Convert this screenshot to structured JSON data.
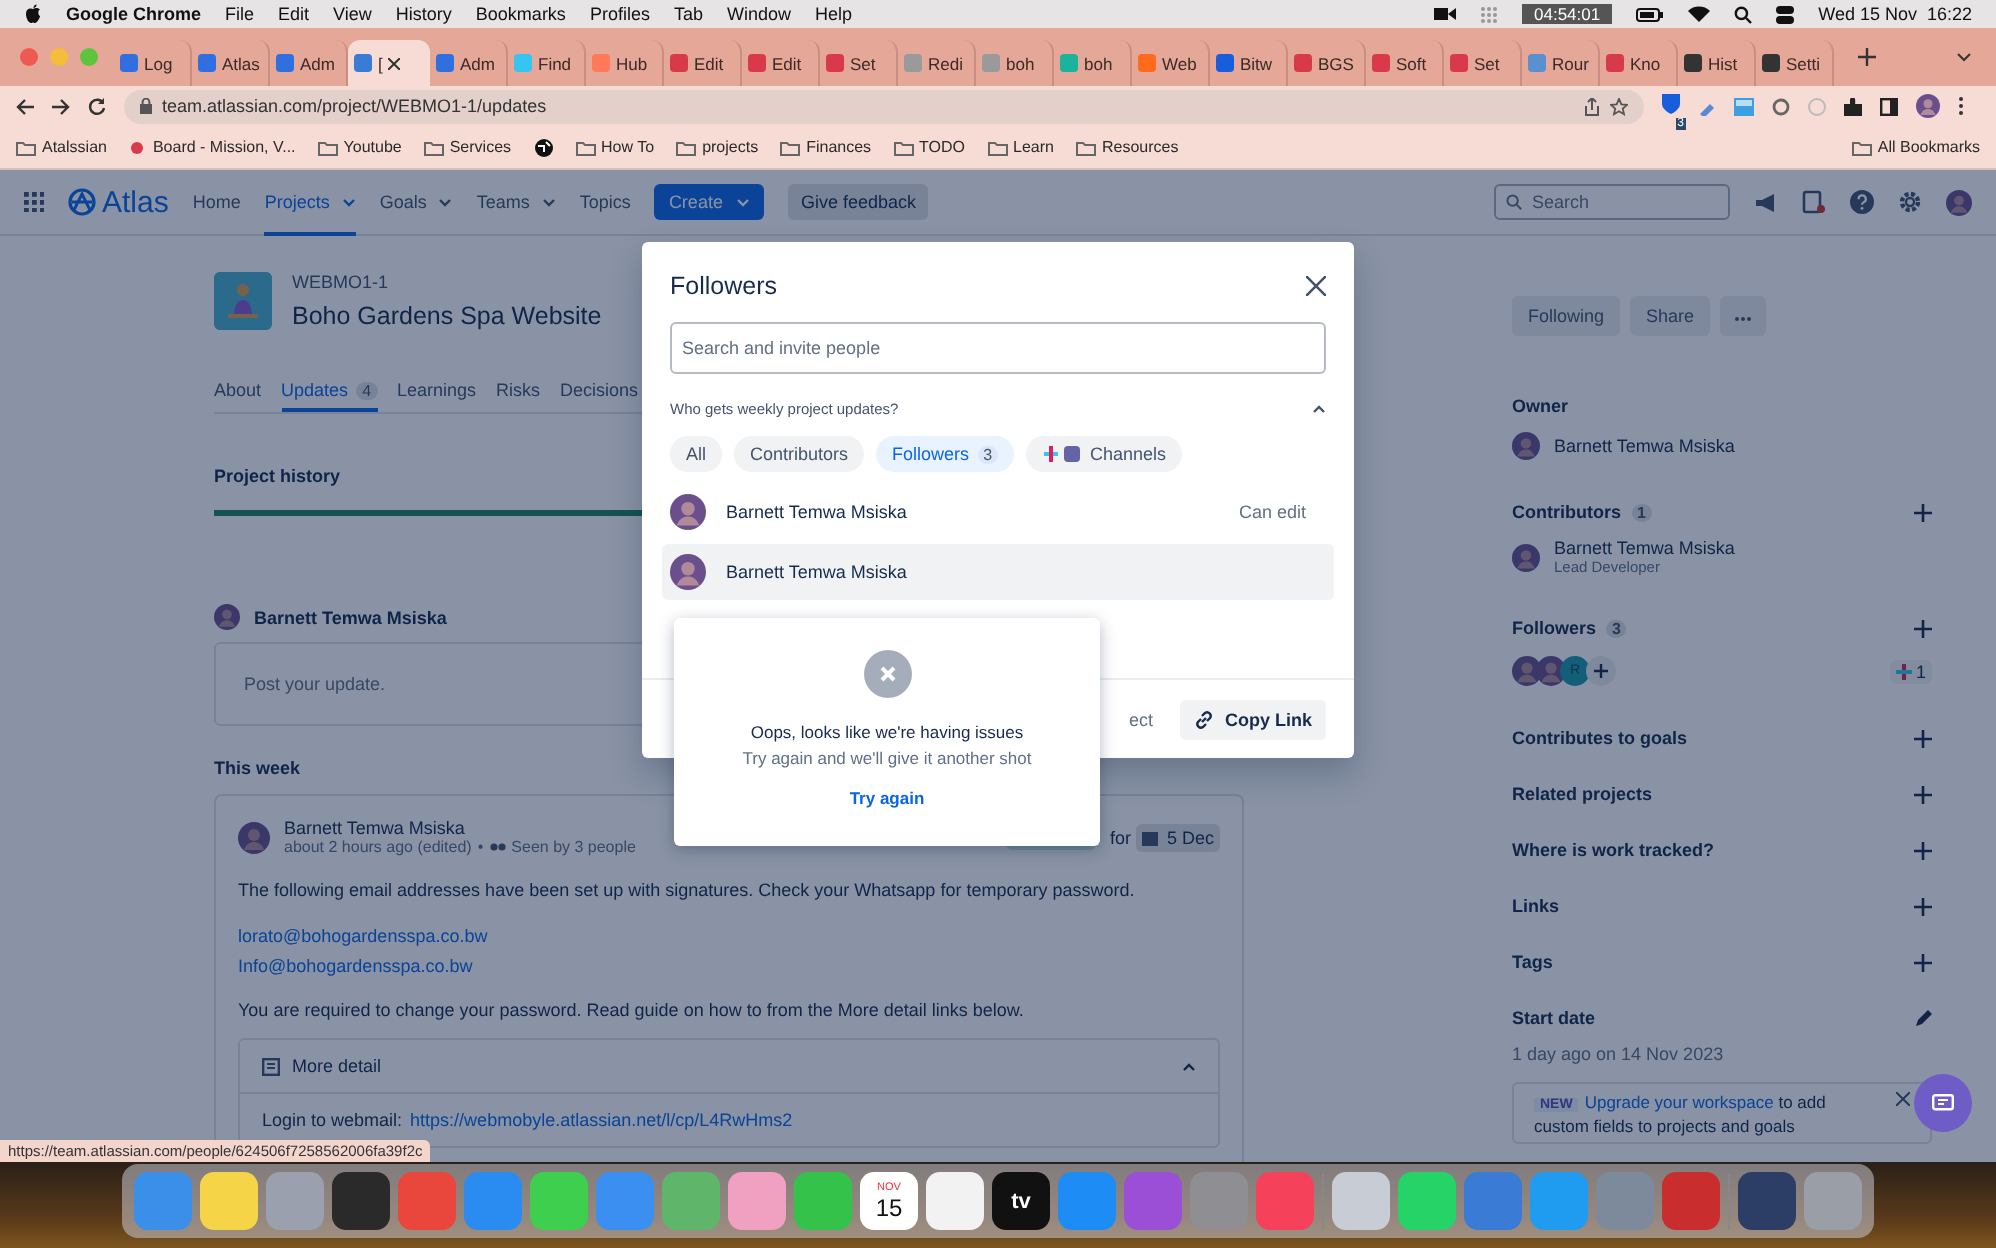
{
  "menu_bar": {
    "app": "Google Chrome",
    "items": [
      "File",
      "Edit",
      "View",
      "History",
      "Bookmarks",
      "Profiles",
      "Tab",
      "Window",
      "Help"
    ],
    "timer": "04:54:01",
    "clock": "Wed 15 Nov  16:22"
  },
  "browser": {
    "tabs": [
      {
        "label": "Log",
        "color": "#2f6fe0",
        "selected": false
      },
      {
        "label": "Atlas",
        "color": "#2f6fe0",
        "selected": false
      },
      {
        "label": "Adm",
        "color": "#2f6fe0",
        "selected": false
      },
      {
        "label": "[",
        "color": "#3a7bd5",
        "selected": true
      },
      {
        "label": "Adm",
        "color": "#2f6fe0",
        "selected": false
      },
      {
        "label": "Find",
        "color": "#36c5f0",
        "selected": false
      },
      {
        "label": "Hub",
        "color": "#ff7a59",
        "selected": false
      },
      {
        "label": "Edit",
        "color": "#d93a4a",
        "selected": false
      },
      {
        "label": "Edit",
        "color": "#d93a4a",
        "selected": false
      },
      {
        "label": "Set",
        "color": "#d93a4a",
        "selected": false
      },
      {
        "label": "Redi",
        "color": "#9a9a9a",
        "selected": false
      },
      {
        "label": "boh",
        "color": "#9a9a9a",
        "selected": false
      },
      {
        "label": "boh",
        "color": "#1bb39b",
        "selected": false
      },
      {
        "label": "Web",
        "color": "#ff6a1f",
        "selected": false
      },
      {
        "label": "Bitw",
        "color": "#175ddc",
        "selected": false
      },
      {
        "label": "BGS",
        "color": "#d93a4a",
        "selected": false
      },
      {
        "label": "Soft",
        "color": "#d93a4a",
        "selected": false
      },
      {
        "label": "Set",
        "color": "#d93a4a",
        "selected": false
      },
      {
        "label": "Rour",
        "color": "#5a8fd0",
        "selected": false
      },
      {
        "label": "Kno",
        "color": "#d93a4a",
        "selected": false
      },
      {
        "label": "Hist",
        "color": "#333333",
        "selected": false
      },
      {
        "label": "Setti",
        "color": "#333333",
        "selected": false
      }
    ],
    "url": "team.atlassian.com/project/WEBMO1-1/updates",
    "extension_badge": "3",
    "bookmarks": [
      {
        "kind": "folder",
        "label": "Atalssian"
      },
      {
        "kind": "page",
        "label": "Board - Mission, V..."
      },
      {
        "kind": "folder",
        "label": "Youtube"
      },
      {
        "kind": "folder",
        "label": "Services"
      },
      {
        "kind": "globe"
      },
      {
        "kind": "folder",
        "label": "How To"
      },
      {
        "kind": "folder",
        "label": "projects"
      },
      {
        "kind": "folder",
        "label": "Finances"
      },
      {
        "kind": "folder",
        "label": "TODO"
      },
      {
        "kind": "folder",
        "label": "Learn"
      },
      {
        "kind": "folder",
        "label": "Resources"
      }
    ],
    "all_bookmarks": "All Bookmarks",
    "status_url": "https://team.atlassian.com/people/624506f7258562006fa39f2c"
  },
  "nav": {
    "logo": "Atlas",
    "items": [
      {
        "label": "Home",
        "selected": false,
        "dropdown": false
      },
      {
        "label": "Projects",
        "selected": true,
        "dropdown": true
      },
      {
        "label": "Goals",
        "selected": false,
        "dropdown": true
      },
      {
        "label": "Teams",
        "selected": false,
        "dropdown": true
      },
      {
        "label": "Topics",
        "selected": false,
        "dropdown": false
      }
    ],
    "create": "Create",
    "feedback": "Give feedback",
    "search_placeholder": "Search"
  },
  "project": {
    "key": "WEBMO1-1",
    "name": "Boho Gardens Spa Website",
    "tabs": [
      {
        "label": "About",
        "selected": false
      },
      {
        "label": "Updates",
        "count": "4",
        "selected": true
      },
      {
        "label": "Learnings",
        "selected": false
      },
      {
        "label": "Risks",
        "selected": false
      },
      {
        "label": "Decisions",
        "selected": false
      }
    ],
    "history_title": "Project history",
    "composer": {
      "author": "Barnett Temwa Msiska",
      "placeholder": "Post your update."
    },
    "section": "This week",
    "update": {
      "author": "Barnett Temwa Msiska",
      "time": "about 2 hours ago (edited)",
      "separator": "•",
      "seen": "Seen by 3 people",
      "due_prefix": "for",
      "due": "5 Dec",
      "paragraphs": [
        {
          "kind": "text",
          "text": "The following email addresses have been set up with signatures. Check your Whatsapp for temporary password."
        },
        {
          "kind": "link",
          "text": "lorato@bohogardensspa.co.bw"
        },
        {
          "kind": "link",
          "text": "Info@bohogardensspa.co.bw"
        },
        {
          "kind": "text",
          "text": "You are required to change your password. Read guide on how to from the More detail links below."
        }
      ],
      "detail": {
        "title": "More detail",
        "expanded": true,
        "line_label": "Login to webmail:",
        "line_link": "https://webmobyle.atlassian.net/l/cp/L4RwHms2"
      }
    }
  },
  "sidebar": {
    "buttons": [
      "Following",
      "Share"
    ],
    "sections": [
      {
        "kind": "person",
        "title": "Owner",
        "add": false,
        "name": "Barnett Temwa Msiska"
      },
      {
        "kind": "person",
        "title": "Contributors",
        "count": "1",
        "add": true,
        "name": "Barnett Temwa Msiska",
        "role": "Lead Developer"
      },
      {
        "kind": "followers",
        "title": "Followers",
        "count": "3",
        "add": true,
        "initial": "R",
        "channel_count": "1"
      },
      {
        "kind": "plain",
        "title": "Contributes to goals",
        "add": true
      },
      {
        "kind": "plain",
        "title": "Related projects",
        "add": true
      },
      {
        "kind": "plain",
        "title": "Where is work tracked?",
        "add": true
      },
      {
        "kind": "plain",
        "title": "Links",
        "add": true
      },
      {
        "kind": "plain",
        "title": "Tags",
        "add": true
      },
      {
        "kind": "date",
        "title": "Start date",
        "add": false,
        "value": "1 day ago on 14 Nov 2023"
      }
    ],
    "banner": {
      "badge": "NEW",
      "link": "Upgrade your workspace",
      "text": "to add custom fields to projects and goals"
    }
  },
  "modal": {
    "title": "Followers",
    "search_placeholder": "Search and invite people",
    "question": "Who gets weekly project updates?",
    "expanded": true,
    "filters": [
      {
        "label": "All",
        "kind": "plain",
        "selected": false
      },
      {
        "label": "Contributors",
        "kind": "plain",
        "selected": false
      },
      {
        "label": "Followers",
        "kind": "plain",
        "count": "3",
        "selected": true
      },
      {
        "label": "Channels",
        "kind": "channels",
        "selected": false
      }
    ],
    "people": [
      {
        "name": "Barnett Temwa Msiska",
        "permission": "Can edit",
        "highlighted": false
      },
      {
        "name": "Barnett Temwa Msiska",
        "highlighted": true
      }
    ],
    "footer_partial": "ect",
    "copy_link": "Copy Link"
  },
  "error": {
    "title": "Oops, looks like we're having issues",
    "message": "Try again and we'll give it another shot",
    "action": "Try again"
  },
  "dock": [
    {
      "kind": "app",
      "color": "#3b8fe8"
    },
    {
      "kind": "app",
      "color": "#f5d547"
    },
    {
      "kind": "app",
      "color": "#9aa0ad"
    },
    {
      "kind": "app",
      "color": "#2a2a2a"
    },
    {
      "kind": "app",
      "color": "#e9473b"
    },
    {
      "kind": "app",
      "color": "#2a8cf0"
    },
    {
      "kind": "app",
      "color": "#3ecf4f"
    },
    {
      "kind": "app",
      "color": "#3a8ff0"
    },
    {
      "kind": "app",
      "color": "#5fb56a"
    },
    {
      "kind": "app",
      "color": "#f0a0c0"
    },
    {
      "kind": "app",
      "color": "#35c24a"
    },
    {
      "kind": "calendar",
      "color": "#ffffff",
      "month": "NOV",
      "day": "15"
    },
    {
      "kind": "app",
      "color": "#f2f2f2"
    },
    {
      "kind": "labeled",
      "color": "#111111",
      "label": "tv"
    },
    {
      "kind": "app",
      "color": "#1e8cf5"
    },
    {
      "kind": "app",
      "color": "#9b4fd6"
    },
    {
      "kind": "app",
      "color": "#8e8e93"
    },
    {
      "kind": "app",
      "color": "#f5425a"
    },
    {
      "kind": "separator"
    },
    {
      "kind": "app",
      "color": "#c8ccd4"
    },
    {
      "kind": "app",
      "color": "#25d366"
    },
    {
      "kind": "app",
      "color": "#3a7bd5"
    },
    {
      "kind": "app",
      "color": "#1f9cf0"
    },
    {
      "kind": "app",
      "color": "#7c8a9c"
    },
    {
      "kind": "app",
      "color": "#c92d2d"
    },
    {
      "kind": "separator"
    },
    {
      "kind": "app",
      "color": "#2c3e66"
    },
    {
      "kind": "app",
      "color": "#9a9ea6"
    }
  ]
}
